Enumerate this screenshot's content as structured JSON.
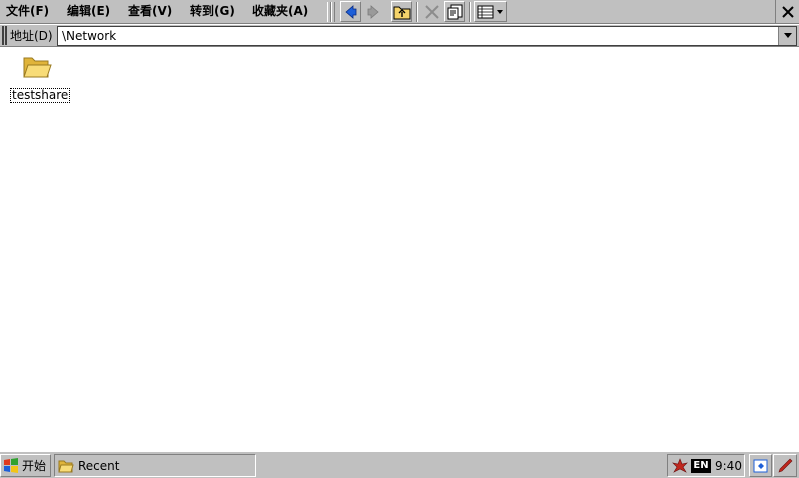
{
  "menu": {
    "items": [
      {
        "label": "文件(F)"
      },
      {
        "label": "编辑(E)"
      },
      {
        "label": "查看(V)"
      },
      {
        "label": "转到(G)"
      },
      {
        "label": "收藏夹(A)"
      }
    ]
  },
  "toolbar": {
    "buttons": [
      "back-icon",
      "forward-icon",
      "up-folder-icon",
      "delete-icon",
      "properties-icon",
      "view-options-icon"
    ]
  },
  "address": {
    "label": "地址(D)",
    "value": "\\Network"
  },
  "content": {
    "items": [
      {
        "name": "testshare",
        "icon": "folder-icon"
      }
    ]
  },
  "taskbar": {
    "start_label": "开始",
    "tasks": [
      {
        "label": "Recent",
        "icon": "folder-icon"
      }
    ],
    "input_mode": "EN",
    "clock": "9:40"
  },
  "colors": {
    "chrome": "#c0c0c0",
    "window_bg": "#ffffff",
    "folder_yellow": "#f5d36a",
    "nav_blue": "#1e5fd8"
  }
}
